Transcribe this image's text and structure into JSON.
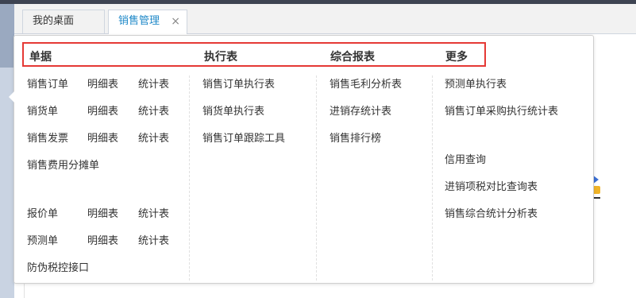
{
  "tabs": [
    {
      "label": "我的桌面"
    },
    {
      "label": "销售管理",
      "close": "×"
    }
  ],
  "menu": {
    "headers": {
      "documents": "单据",
      "execution": "执行表",
      "reports": "综合报表",
      "more": "更多"
    },
    "documents": {
      "sales_order": {
        "main": "销售订单",
        "detail": "明细表",
        "stats": "统计表"
      },
      "sales_delivery": {
        "main": "销货单",
        "detail": "明细表",
        "stats": "统计表"
      },
      "sales_invoice": {
        "main": "销售发票",
        "detail": "明细表",
        "stats": "统计表"
      },
      "expense_allocation": "销售费用分摊单",
      "quotation": {
        "main": "报价单",
        "detail": "明细表",
        "stats": "统计表"
      },
      "forecast": {
        "main": "预测单",
        "detail": "明细表",
        "stats": "统计表"
      },
      "anti_counterfeit": "防伪税控接口"
    },
    "execution": [
      "销售订单执行表",
      "销货单执行表",
      "销售订单跟踪工具"
    ],
    "reports": [
      "销售毛利分析表",
      "进销存统计表",
      "销售排行榜"
    ],
    "more": {
      "forecast_exec": "预测单执行表",
      "order_purchase_exec": "销售订单采购执行统计表",
      "credit_query": "信用查询",
      "tax_comparison": "进销项税对比查询表",
      "sales_analysis": "销售综合统计分析表"
    }
  },
  "colors": {
    "active_tab": "#1e88c8",
    "highlight_border": "#e53935",
    "topbar": "#3e4452"
  }
}
